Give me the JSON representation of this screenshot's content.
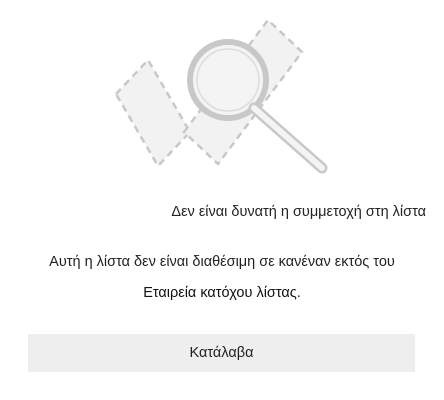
{
  "dialog": {
    "title": "Δεν είναι δυνατή η συμμετοχή στη λίστα",
    "message_prefix": "Αυτή η λίστα δεν είναι διαθέσιμη σε κανέναν εκτός του",
    "owner_name": "Εταιρεία κατόχου λίστας",
    "message_suffix": ".",
    "ok_label": "Κατάλαβα",
    "illustration_icon": "search-magnifier-icon"
  },
  "colors": {
    "illustration_stroke": "#c8c8c8",
    "illustration_fill": "#f2f2f2",
    "button_background": "#eeeeee",
    "text": "#222222"
  }
}
